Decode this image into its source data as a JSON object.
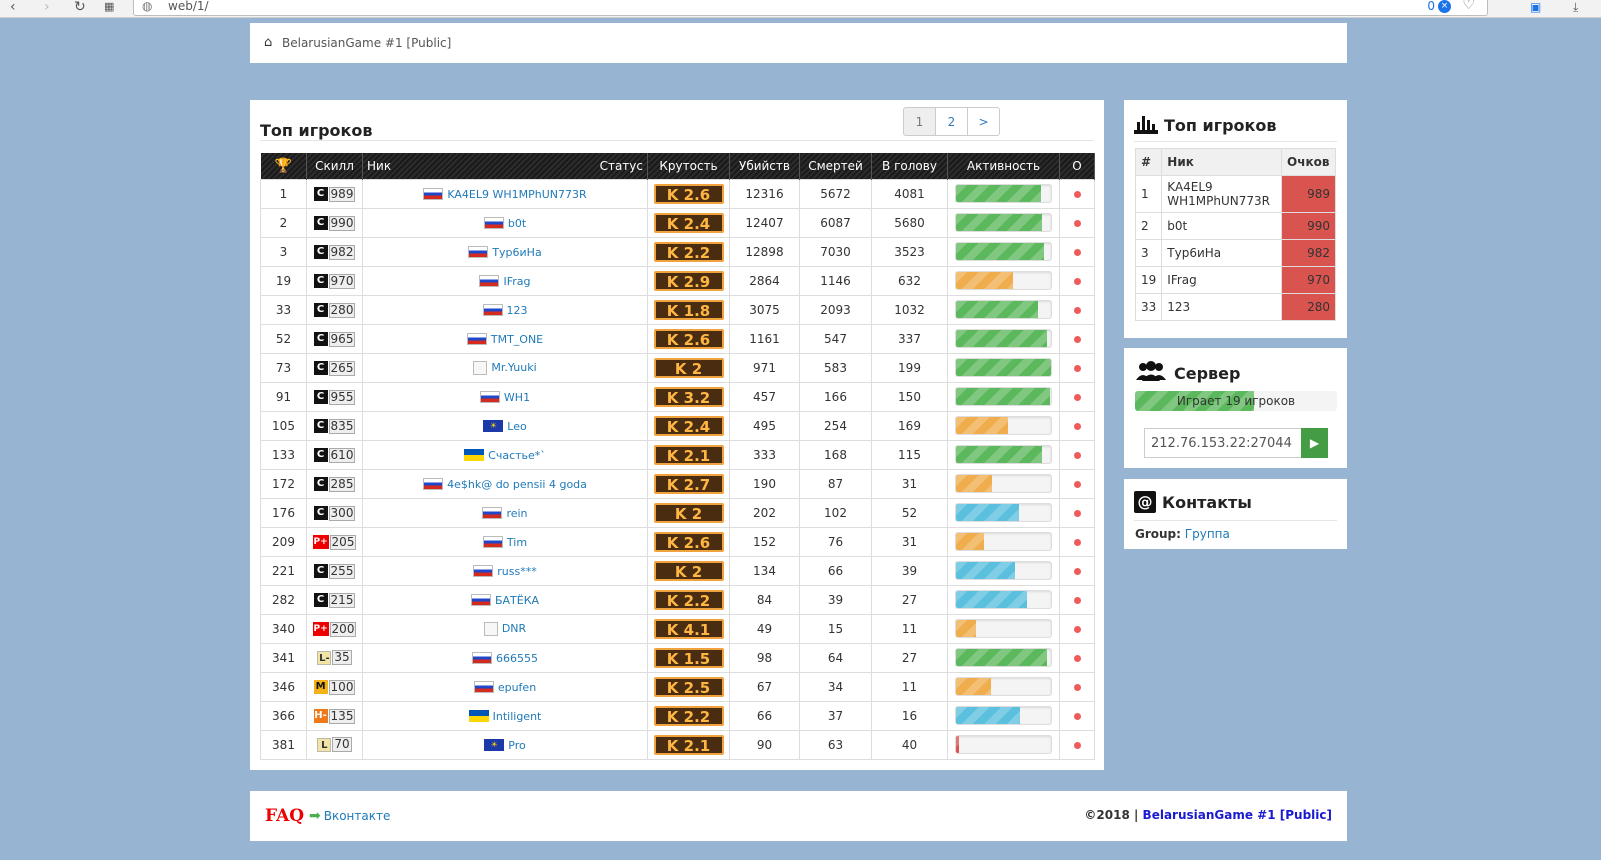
{
  "browser": {
    "url": "web/1/",
    "zoom": "0"
  },
  "breadcrumb": {
    "label": "BelarusianGame #1 [Public]"
  },
  "main": {
    "title": "Топ игроков",
    "pager": [
      "1",
      "2",
      ">"
    ],
    "headers": [
      "Скилл",
      "Ник",
      "Статус",
      "Крутость",
      "Убийств",
      "Смертей",
      "В голову",
      "Активность",
      "О"
    ],
    "rows": [
      {
        "rank": "1",
        "badge": "C",
        "skill": "989",
        "flag": "ru",
        "nick": "KA4EL9 WH1MPhUN773R",
        "k": "K 2.6",
        "kills": "12316",
        "deaths": "5672",
        "hs": "4081",
        "act": 0.89,
        "color": "g"
      },
      {
        "rank": "2",
        "badge": "C",
        "skill": "990",
        "flag": "ru",
        "nick": "b0t",
        "k": "K 2.4",
        "kills": "12407",
        "deaths": "6087",
        "hs": "5680",
        "act": 0.91,
        "color": "g"
      },
      {
        "rank": "3",
        "badge": "C",
        "skill": "982",
        "flag": "ru",
        "nick": "Тур6иНа",
        "k": "K 2.2",
        "kills": "12898",
        "deaths": "7030",
        "hs": "3523",
        "act": 0.93,
        "color": "g"
      },
      {
        "rank": "19",
        "badge": "C",
        "skill": "970",
        "flag": "ru",
        "nick": "IFrag",
        "k": "K 2.9",
        "kills": "2864",
        "deaths": "1146",
        "hs": "632",
        "act": 0.6,
        "color": "o"
      },
      {
        "rank": "33",
        "badge": "C",
        "skill": "280",
        "flag": "ru",
        "nick": "123",
        "k": "K 1.8",
        "kills": "3075",
        "deaths": "2093",
        "hs": "1032",
        "act": 0.86,
        "color": "g"
      },
      {
        "rank": "52",
        "badge": "C",
        "skill": "965",
        "flag": "ru",
        "nick": "TMT_ONE",
        "k": "K 2.6",
        "kills": "1161",
        "deaths": "547",
        "hs": "337",
        "act": 0.96,
        "color": "g"
      },
      {
        "rank": "73",
        "badge": "C",
        "skill": "265",
        "flag": "img",
        "nick": "Mr.Yuuki",
        "k": "K 2",
        "kills": "971",
        "deaths": "583",
        "hs": "199",
        "act": 1.0,
        "color": "g"
      },
      {
        "rank": "91",
        "badge": "C",
        "skill": "955",
        "flag": "ru",
        "nick": "WH1",
        "k": "K 3.2",
        "kills": "457",
        "deaths": "166",
        "hs": "150",
        "act": 0.99,
        "color": "g"
      },
      {
        "rank": "105",
        "badge": "C",
        "skill": "835",
        "flag": "kz",
        "nick": "Leo",
        "k": "K 2.4",
        "kills": "495",
        "deaths": "254",
        "hs": "169",
        "act": 0.55,
        "color": "o"
      },
      {
        "rank": "133",
        "badge": "C",
        "skill": "610",
        "flag": "ua",
        "nick": "Счастье*`",
        "k": "K 2.1",
        "kills": "333",
        "deaths": "168",
        "hs": "115",
        "act": 0.91,
        "color": "g"
      },
      {
        "rank": "172",
        "badge": "C",
        "skill": "285",
        "flag": "ru",
        "nick": "4e$hk@ do pensii 4 goda",
        "k": "K 2.7",
        "kills": "190",
        "deaths": "87",
        "hs": "31",
        "act": 0.38,
        "color": "o"
      },
      {
        "rank": "176",
        "badge": "C",
        "skill": "300",
        "flag": "ru",
        "nick": "rein",
        "k": "K 2",
        "kills": "202",
        "deaths": "102",
        "hs": "52",
        "act": 0.66,
        "color": "b"
      },
      {
        "rank": "209",
        "badge": "P+",
        "skill": "205",
        "flag": "ru",
        "nick": "Tim",
        "k": "K 2.6",
        "kills": "152",
        "deaths": "76",
        "hs": "31",
        "act": 0.29,
        "color": "o"
      },
      {
        "rank": "221",
        "badge": "C",
        "skill": "255",
        "flag": "ru",
        "nick": "russ***",
        "k": "K 2",
        "kills": "134",
        "deaths": "66",
        "hs": "39",
        "act": 0.62,
        "color": "b"
      },
      {
        "rank": "282",
        "badge": "C",
        "skill": "215",
        "flag": "ru",
        "nick": "БАТЁКА",
        "k": "K 2.2",
        "kills": "84",
        "deaths": "39",
        "hs": "27",
        "act": 0.75,
        "color": "b"
      },
      {
        "rank": "340",
        "badge": "P+",
        "skill": "200",
        "flag": "img",
        "nick": "DNR",
        "k": "K 4.1",
        "kills": "49",
        "deaths": "15",
        "hs": "11",
        "act": 0.21,
        "color": "o"
      },
      {
        "rank": "341",
        "badge": "L-",
        "skill": "35",
        "flag": "ru",
        "nick": "666555",
        "k": "K 1.5",
        "kills": "98",
        "deaths": "64",
        "hs": "27",
        "act": 0.96,
        "color": "g"
      },
      {
        "rank": "346",
        "badge": "M",
        "skill": "100",
        "flag": "ru",
        "nick": "epufen",
        "k": "K 2.5",
        "kills": "67",
        "deaths": "34",
        "hs": "11",
        "act": 0.37,
        "color": "o"
      },
      {
        "rank": "366",
        "badge": "H-",
        "skill": "135",
        "flag": "ua",
        "nick": "Intiligent",
        "k": "K 2.2",
        "kills": "66",
        "deaths": "37",
        "hs": "16",
        "act": 0.67,
        "color": "b"
      },
      {
        "rank": "381",
        "badge": "L",
        "skill": "70",
        "flag": "kz",
        "nick": "Pro",
        "k": "K 2.1",
        "kills": "90",
        "deaths": "63",
        "hs": "40",
        "act": 0.03,
        "color": "r"
      }
    ]
  },
  "sidebar": {
    "top": {
      "title": "Топ игроков",
      "headers": [
        "#",
        "Ник",
        "Очков"
      ],
      "rows": [
        {
          "rank": "1",
          "nick": "KA4EL9 WH1MPhUN773R",
          "pts": "989"
        },
        {
          "rank": "2",
          "nick": "b0t",
          "pts": "990"
        },
        {
          "rank": "3",
          "nick": "Тур6иНа",
          "pts": "982"
        },
        {
          "rank": "19",
          "nick": "IFrag",
          "pts": "970"
        },
        {
          "rank": "33",
          "nick": "123",
          "pts": "280"
        }
      ]
    },
    "server": {
      "title": "Сервер",
      "players_text": "Играет 19 игроков",
      "fill": 0.59,
      "address": "212.76.153.22:27044"
    },
    "contacts": {
      "title": "Контакты",
      "group_label": "Group:",
      "group_link": "Группа"
    }
  },
  "footer": {
    "faq": "FAQ",
    "vk": "Вконтакте",
    "copy": "©2018 |",
    "server_name": "BelarusianGame #1 [Public]"
  },
  "colors": {
    "background": "#98b4d3",
    "link": "#1f7ab9",
    "green": "#5cb85c",
    "orange": "#f0ad4e",
    "blue": "#5bc0de",
    "red": "#d9534f"
  }
}
